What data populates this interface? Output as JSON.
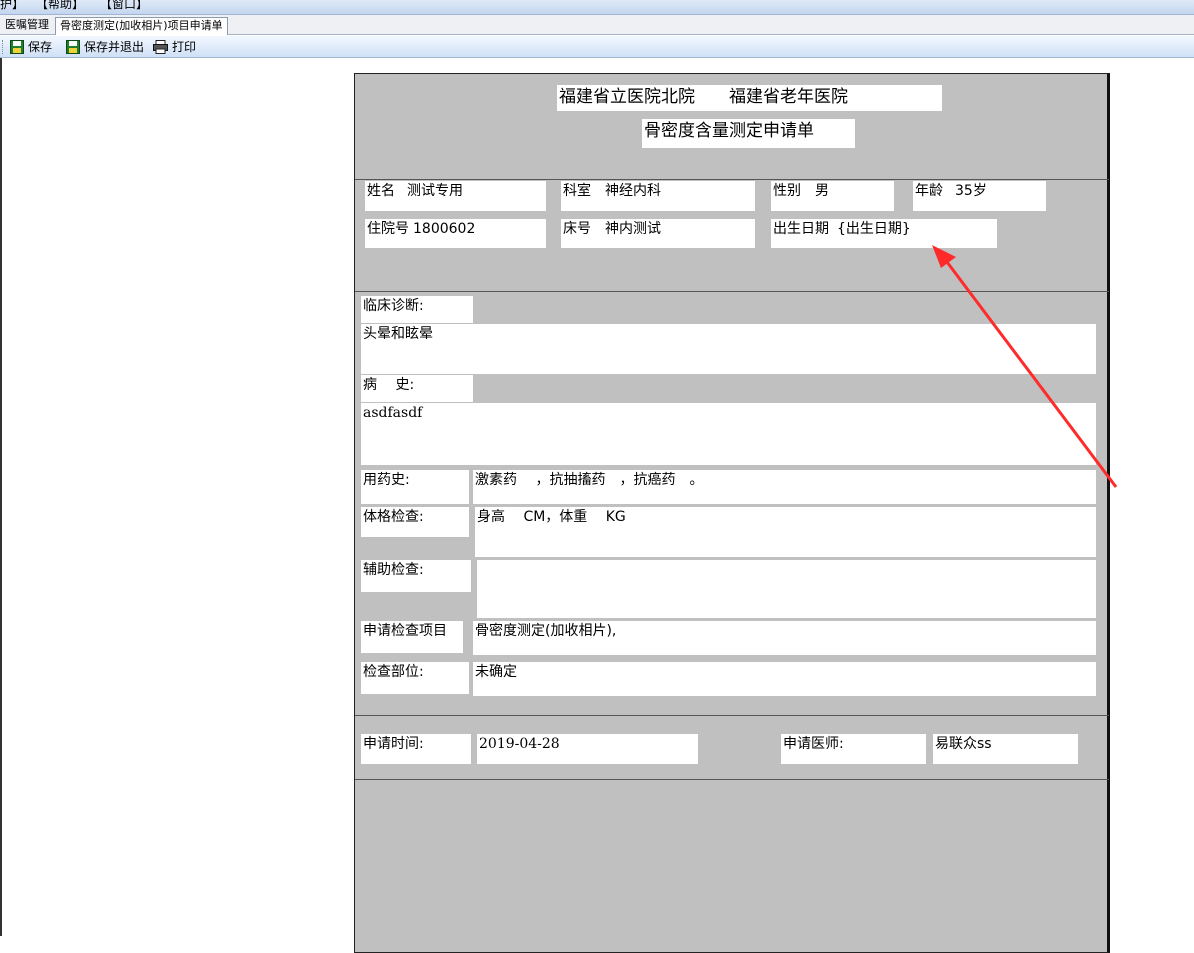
{
  "menu": {
    "items": [
      "护】",
      "【帮助】",
      "【窗口】"
    ]
  },
  "tabs": [
    {
      "label": "医嘱管理",
      "active": false
    },
    {
      "label": "骨密度测定(加收相片)项目申请单",
      "active": true
    }
  ],
  "toolbar": {
    "save_label": "保存",
    "save_exit_label": "保存并退出",
    "print_label": "打印"
  },
  "form": {
    "hospital_name": "福建省立医院北院　　福建省老年医院",
    "form_title": "骨密度含量测定申请单",
    "name_label": "姓名",
    "name_value": "测试专用",
    "dept_label": "科室",
    "dept_value": "神经内科",
    "sex_label": "性别",
    "sex_value": "男",
    "age_label": "年龄",
    "age_value": "35岁",
    "inpatient_no_label": "住院号",
    "inpatient_no_value": "1800602",
    "bed_label": "床号",
    "bed_value": "神内测试",
    "birth_label": "出生日期",
    "birth_value": "{出生日期}",
    "diagnosis_label": "临床诊断:",
    "diagnosis_value": "头晕和眩晕",
    "history_label": "病　 史:",
    "history_value": "asdfasdf",
    "medication_label": "用药史:",
    "medication_value": "激素药　 ，抗抽搐药　，抗癌药　。",
    "physical_label": "体格检查:",
    "physical_value": "身高　 CM，体重　 KG",
    "aux_label": "辅助检查:",
    "aux_value": "",
    "item_label": "申请检查项目",
    "item_value": "骨密度测定(加收相片),",
    "site_label": "检查部位:",
    "site_value": "未确定",
    "time_label": "申请时间:",
    "time_value": "2019-04-28",
    "doctor_label": "申请医师:",
    "doctor_value": "易联众ss"
  },
  "colors": {
    "form_background": "#c0c0c0",
    "annotation_arrow": "#ff2a2a"
  },
  "icons": {
    "save": "floppy-disk-icon",
    "save_exit": "floppy-disk-icon",
    "print": "printer-icon"
  }
}
